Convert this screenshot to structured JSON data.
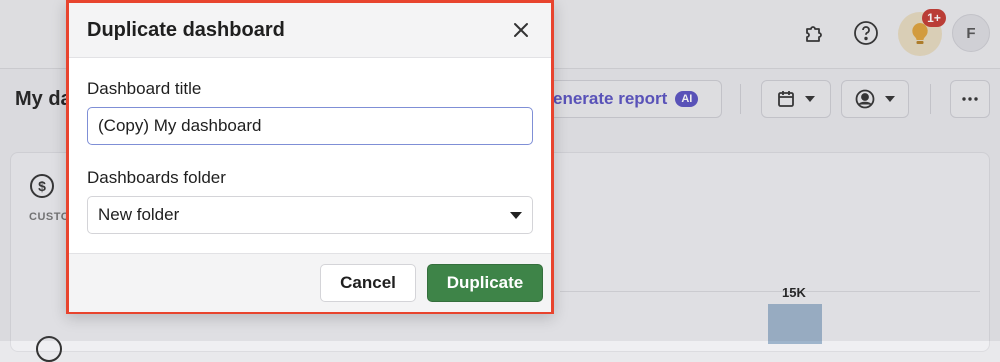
{
  "header": {
    "notification_count": "1+",
    "avatar_initial": "F",
    "icons": [
      "puzzle-icon",
      "help-icon",
      "lightbulb-icon"
    ]
  },
  "toolbar": {
    "page_title": "My da",
    "generate_report_label": "enerate report",
    "ai_badge": "AI",
    "accent_color": "#5a52c2"
  },
  "card": {
    "label": "CUSTO",
    "bar_value_label": "15K"
  },
  "modal": {
    "title": "Duplicate dashboard",
    "title_field": {
      "label": "Dashboard title",
      "value": "(Copy) My dashboard",
      "placeholder": ""
    },
    "folder_field": {
      "label": "Dashboards folder",
      "selected": "New folder"
    },
    "cancel_label": "Cancel",
    "duplicate_label": "Duplicate",
    "primary_color": "#3e8448",
    "highlight_color": "#e8442e"
  }
}
